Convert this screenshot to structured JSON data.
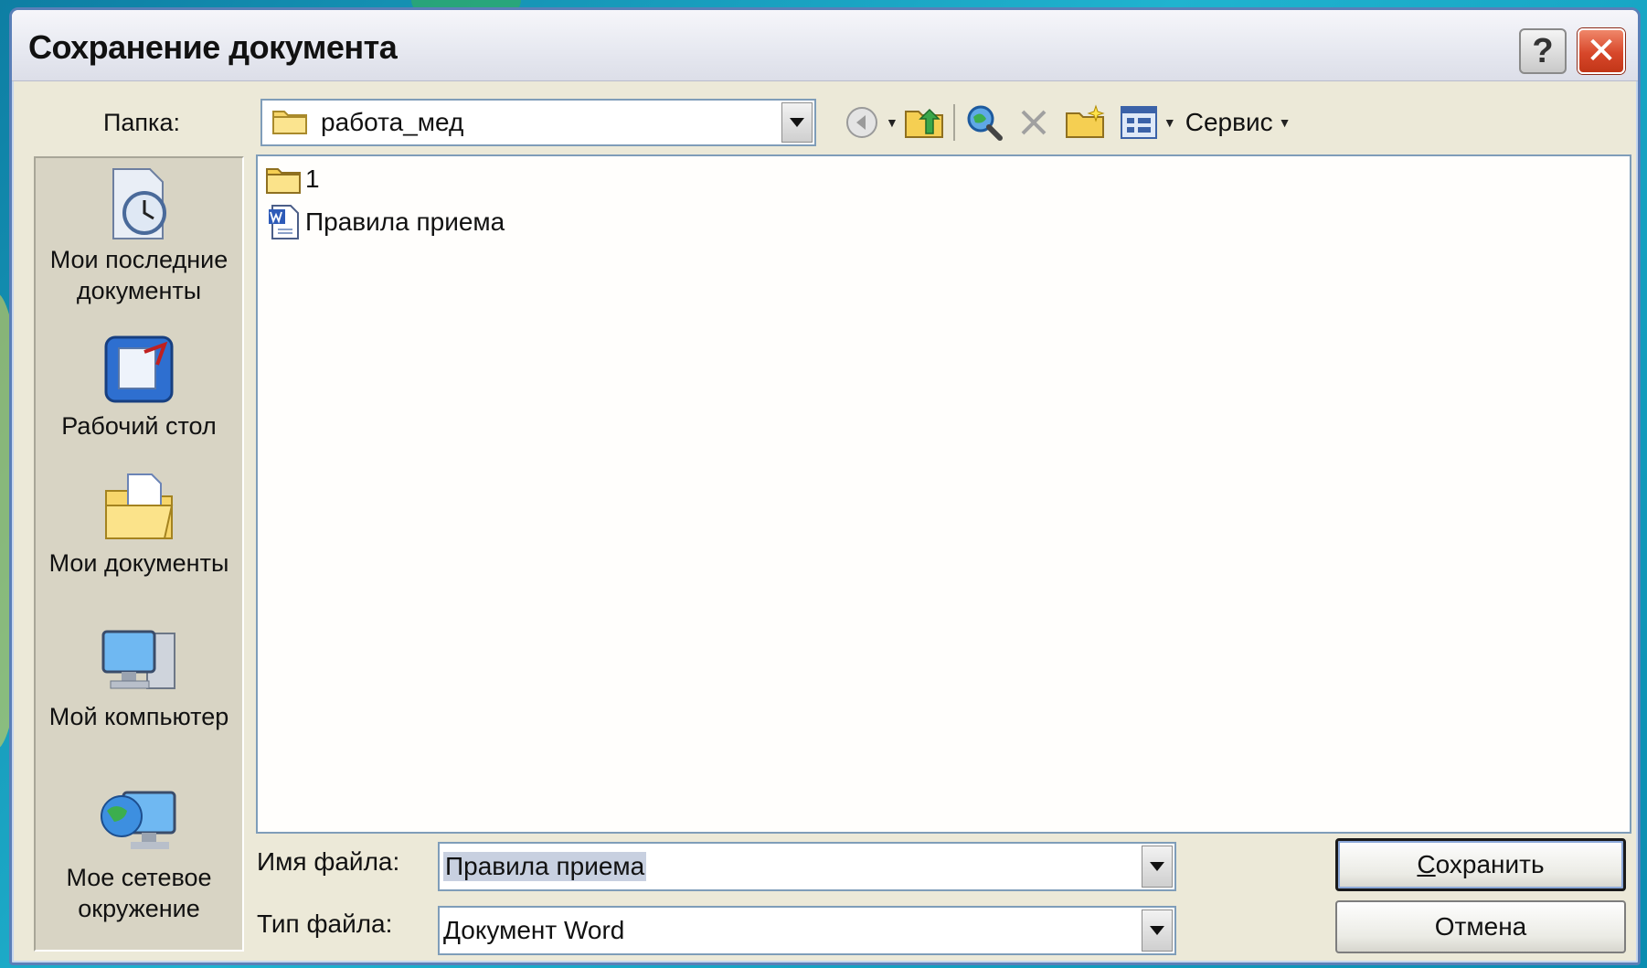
{
  "window": {
    "title": "Сохранение документа"
  },
  "titlebar_buttons": {
    "help": "?",
    "close": "✕"
  },
  "folder": {
    "label": "Папка:",
    "value": "работа_мед"
  },
  "toolbar": {
    "items": [
      "back-icon",
      "up-folder-icon",
      "search-web-icon",
      "delete-icon",
      "new-folder-icon",
      "views-icon"
    ],
    "service_label": "Сервис"
  },
  "places": [
    {
      "label": "Мои последние документы",
      "icon": "recent-documents-icon"
    },
    {
      "label": "Рабочий стол",
      "icon": "desktop-icon"
    },
    {
      "label": "Мои документы",
      "icon": "my-documents-icon"
    },
    {
      "label": "Мой компьютер",
      "icon": "my-computer-icon"
    },
    {
      "label": "Мое сетевое окружение",
      "icon": "network-places-icon"
    }
  ],
  "files": [
    {
      "name": "1",
      "type": "folder"
    },
    {
      "name": "Правила приема",
      "type": "word-document"
    }
  ],
  "filename": {
    "label": "Имя файла:",
    "value": "Правила приема"
  },
  "filetype": {
    "label": "Тип файла:",
    "value": "Документ Word"
  },
  "buttons": {
    "save_prefix": "С",
    "save_rest": "охранить",
    "cancel": "Отмена"
  }
}
